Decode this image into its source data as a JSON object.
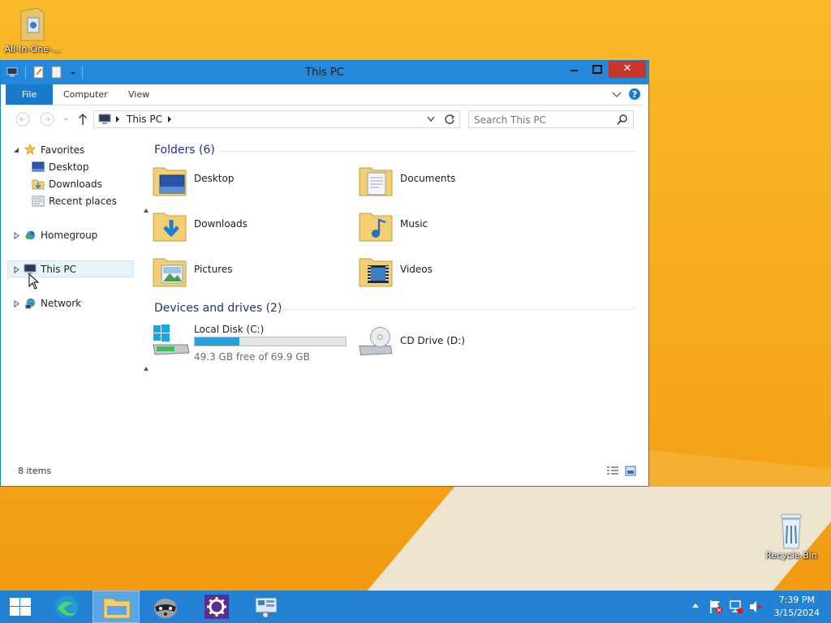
{
  "desktop": {
    "icons": [
      {
        "label": "All-In-One-...",
        "icon": "folder-icon"
      },
      {
        "label": "Recycle Bin",
        "icon": "recycle-bin-icon"
      }
    ]
  },
  "window": {
    "title": "This PC",
    "controls": {
      "minimize": "—",
      "maximize": "☐",
      "close": "✕"
    },
    "ribbon_tabs": [
      "File",
      "Computer",
      "View"
    ],
    "address": {
      "path_root": "This PC"
    },
    "search": {
      "placeholder": "Search This PC"
    },
    "nav": {
      "favorites": "Favorites",
      "desktop": "Desktop",
      "downloads": "Downloads",
      "recent_places": "Recent places",
      "homegroup": "Homegroup",
      "this_pc": "This PC",
      "network": "Network"
    },
    "folders_header": "Folders (6)",
    "folders": [
      {
        "label": "Desktop",
        "icon": "desktop-folder-icon"
      },
      {
        "label": "Documents",
        "icon": "documents-folder-icon"
      },
      {
        "label": "Downloads",
        "icon": "downloads-folder-icon"
      },
      {
        "label": "Music",
        "icon": "music-folder-icon"
      },
      {
        "label": "Pictures",
        "icon": "pictures-folder-icon"
      },
      {
        "label": "Videos",
        "icon": "videos-folder-icon"
      }
    ],
    "drives_header": "Devices and drives (2)",
    "drives": [
      {
        "label": "Local Disk (C:)",
        "free": "49.3 GB free of 69.9 GB",
        "used_fraction": 0.295
      },
      {
        "label": "CD Drive (D:)"
      }
    ],
    "status": "8 items"
  },
  "taskbar": {
    "time": "7:39 PM",
    "date": "3/15/2024"
  },
  "colors": {
    "accent": "#1979ca",
    "taskbar": "#2482d5",
    "drive_bar": "#26a0da"
  }
}
